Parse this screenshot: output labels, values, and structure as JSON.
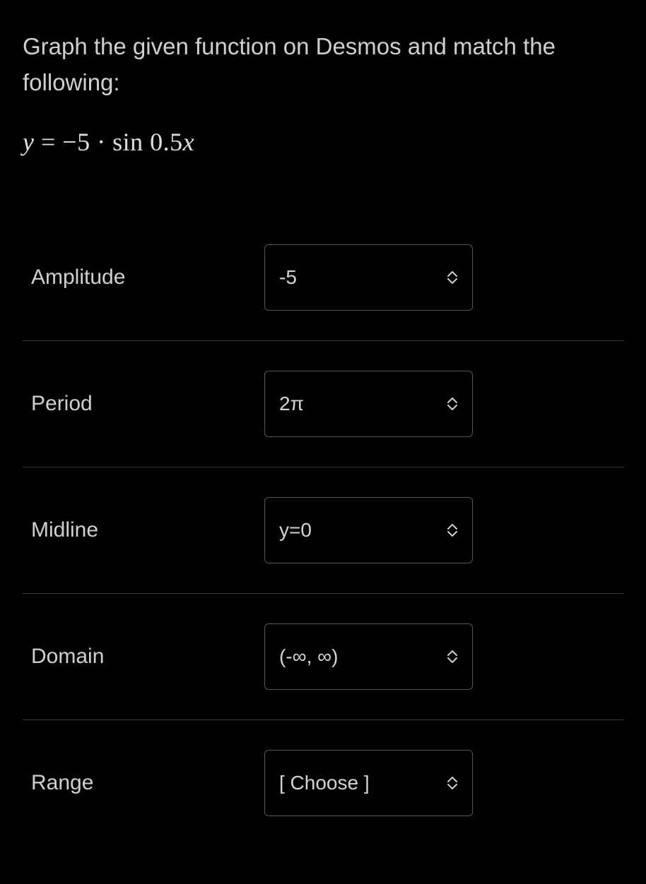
{
  "instruction": "Graph the given function on Desmos and match the following:",
  "equation_html": "<span class='var'>y</span> = −5 · sin 0.5<span class='var'>x</span>",
  "rows": [
    {
      "label": "Amplitude",
      "value": "-5"
    },
    {
      "label": "Period",
      "value": "2π"
    },
    {
      "label": "Midline",
      "value": "y=0"
    },
    {
      "label": "Domain",
      "value": "(-∞, ∞)"
    },
    {
      "label": "Range",
      "value": "[ Choose ]"
    }
  ]
}
